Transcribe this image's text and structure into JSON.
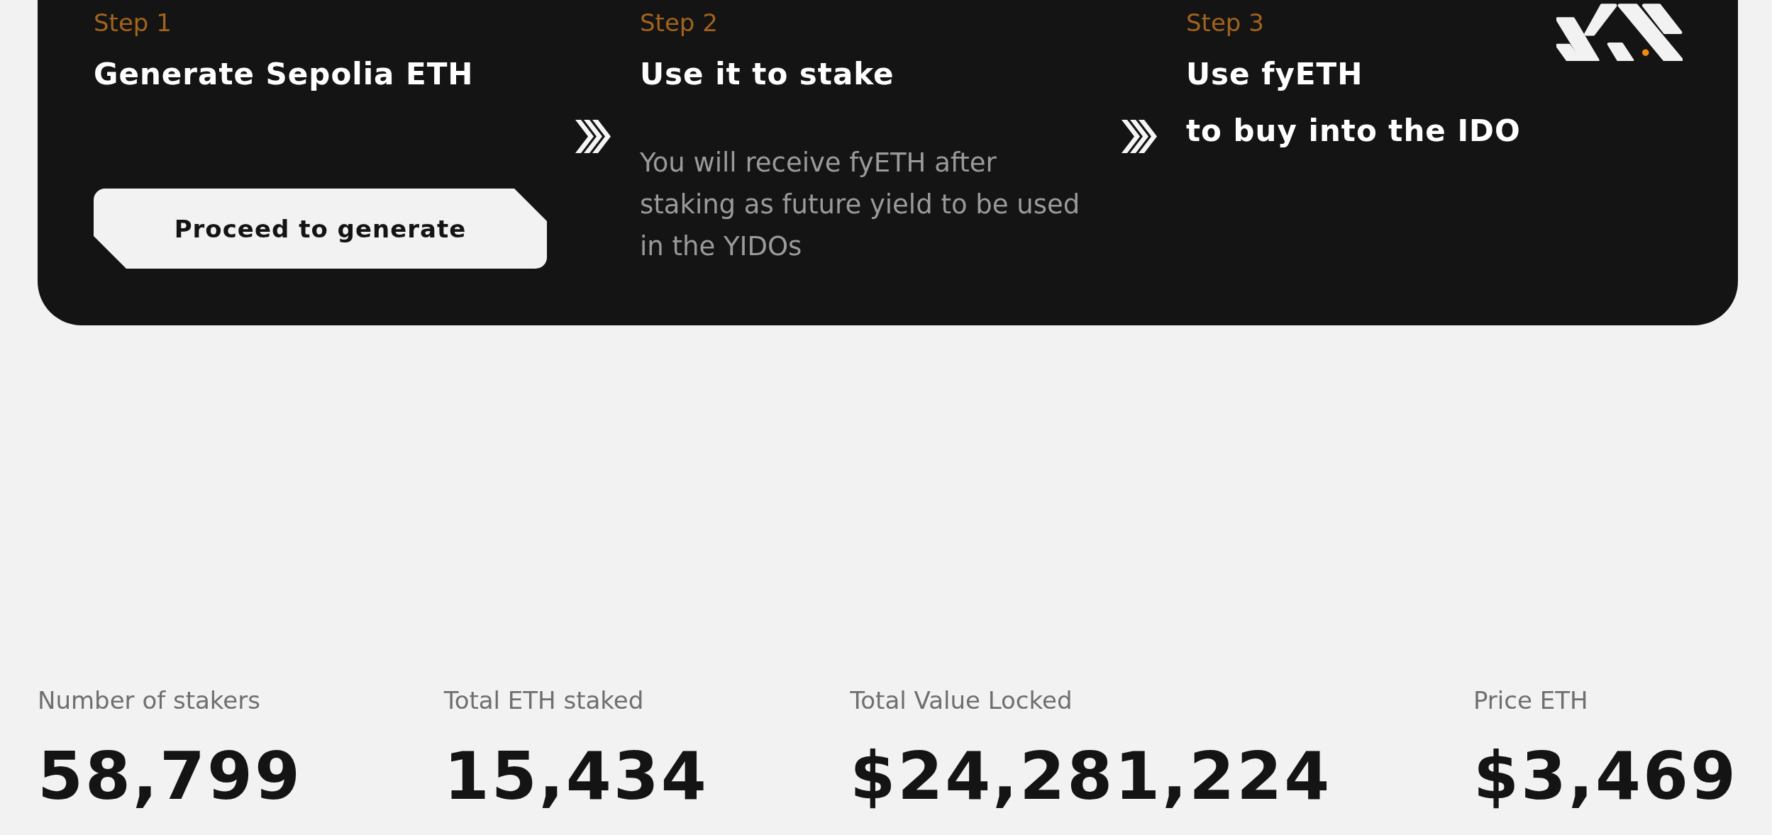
{
  "steps": [
    {
      "label": "Step 1",
      "title_lines": [
        "Generate Sepolia ETH"
      ],
      "button": "Proceed to generate"
    },
    {
      "label": "Step 2",
      "title_lines": [
        "Use it to stake"
      ],
      "description": "You will receive fyETH after staking as future yield to be used in the YIDOs"
    },
    {
      "label": "Step 3",
      "title_lines": [
        "Use fyETH",
        "to buy into the IDO"
      ]
    }
  ],
  "stats": [
    {
      "label": "Number of stakers",
      "value": "58,799"
    },
    {
      "label": "Total ETH staked",
      "value": "15,434"
    },
    {
      "label": "Total Value Locked",
      "value": "$24,281,224"
    },
    {
      "label": "Price ETH",
      "value": "$3,469"
    }
  ]
}
